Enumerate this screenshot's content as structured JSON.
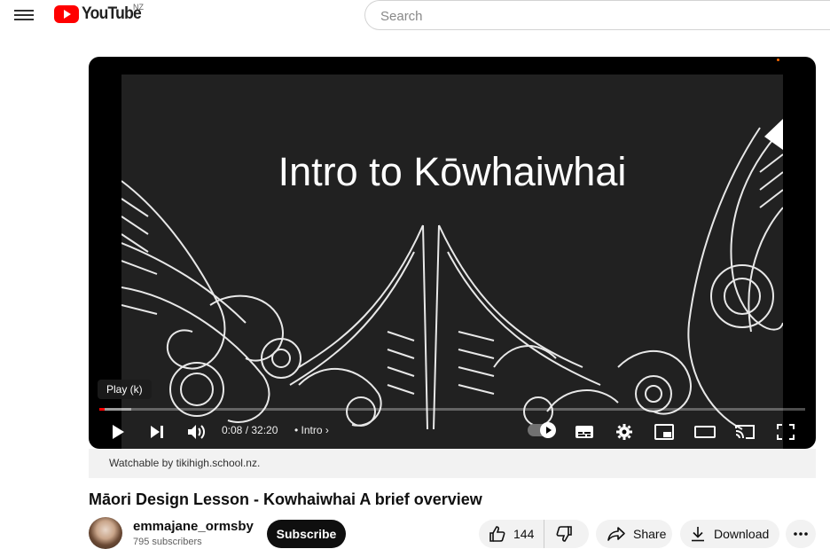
{
  "header": {
    "logo_text": "YouTube",
    "region": "NZ",
    "search_placeholder": "Search"
  },
  "player": {
    "video_title_text": "Intro to Kōwhaiwhai",
    "tooltip": "Play (k)",
    "time": "0:08 / 32:20",
    "chapter": "• Intro",
    "progress_fraction": 0.004,
    "buffer_fraction": 0.045
  },
  "notice": "Watchable by tikihigh.school.nz.",
  "video": {
    "title": "Māori Design Lesson - Kowhaiwhai A brief overview",
    "channel_name": "emmajane_ormsby",
    "subscribers": "795 subscribers",
    "subscribe_label": "Subscribe",
    "likes": "144",
    "share_label": "Share",
    "download_label": "Download"
  },
  "colors": {
    "brand_red": "#ff0000",
    "player_bg": "#000000",
    "video_bg": "#212121"
  }
}
